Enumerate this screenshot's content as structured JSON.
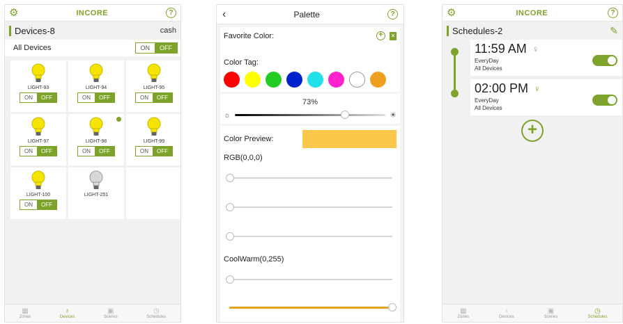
{
  "devices_screen": {
    "brand": "INCORE",
    "help": "?",
    "section_title": "Devices-8",
    "section_right": "cash",
    "all_devices_label": "All Devices",
    "on_label": "ON",
    "off_label": "OFF",
    "lights": [
      {
        "name": "LIGHT-93",
        "state": "on"
      },
      {
        "name": "LIGHT-94",
        "state": "on"
      },
      {
        "name": "LIGHT-95",
        "state": "on"
      },
      {
        "name": "LIGHT-97",
        "state": "on"
      },
      {
        "name": "LIGHT-98",
        "state": "on",
        "badge": true
      },
      {
        "name": "LIGHT-99",
        "state": "on"
      },
      {
        "name": "LIGHT-100",
        "state": "on"
      },
      {
        "name": "LIGHT-251",
        "state": "off"
      }
    ],
    "tabs": [
      "Zones",
      "Devices",
      "Scenes",
      "Schedules"
    ]
  },
  "palette_screen": {
    "title": "Palette",
    "help": "?",
    "favorite_label": "Favorite Color:",
    "color_tag_label": "Color Tag:",
    "swatches": [
      "#ff0000",
      "#ffff00",
      "#22cc22",
      "#0022cc",
      "#22e0e8",
      "#ff22cc",
      "#ffffff",
      "#f0a020"
    ],
    "brightness_pct": "73%",
    "brightness_value": 0.73,
    "preview_label": "Color Preview:",
    "preview_color": "#fcc74a",
    "rgb_label": "RGB(0,0,0)",
    "coolwarm_label": "CoolWarm(0,255)",
    "coolwarm_value": 1.0
  },
  "schedules_screen": {
    "brand": "INCORE",
    "help": "?",
    "section_title": "Schedules-2",
    "items": [
      {
        "time": "11:59 AM",
        "repeat": "EveryDay",
        "target": "All Devices",
        "enabled": true
      },
      {
        "time": "02:00 PM",
        "repeat": "EveryDay",
        "target": "All Devices",
        "enabled": true
      }
    ],
    "tabs": [
      "Zones",
      "Devices",
      "Scenes",
      "Schedules"
    ]
  },
  "colors": {
    "accent": "#7ea32a",
    "bulb_on": "#f4e400",
    "bulb_off": "#d8d8d8"
  }
}
